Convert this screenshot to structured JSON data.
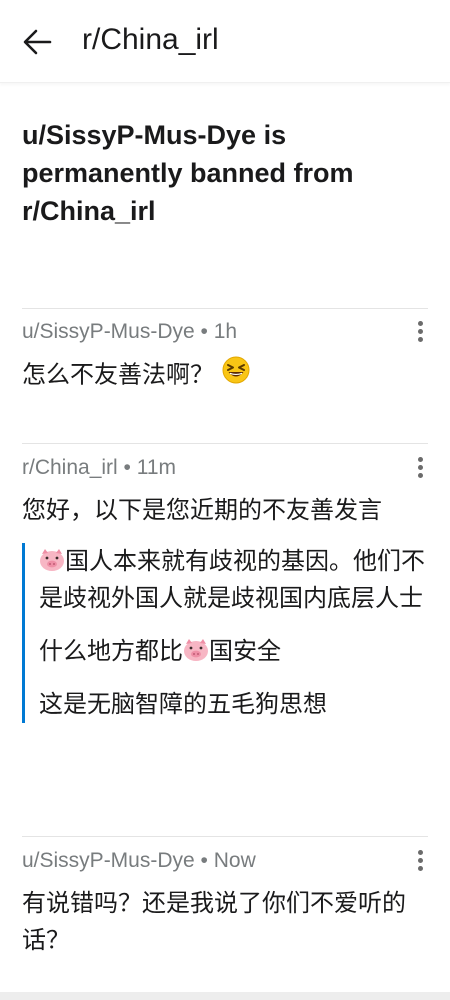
{
  "header": {
    "title": "r/China_irl",
    "back_icon": "back-arrow-icon"
  },
  "post": {
    "title": "u/SissyP-Mus-Dye is permanently banned from r/China_irl"
  },
  "comments": [
    {
      "author": "u/SissyP-Mus-Dye",
      "time": "1h",
      "text": "怎么不友善法啊？",
      "emoji": "grinning-squinting-face-icon"
    },
    {
      "author": "r/China_irl",
      "time": "11m",
      "text": "您好，以下是您近期的不友善发言",
      "quotes": [
        {
          "before": "",
          "pig": true,
          "after": "国人本来就有歧视的基因。他们不是歧视外国人就是歧视国内底层人士"
        },
        {
          "before": "什么地方都比",
          "pig": true,
          "after": "国安全"
        },
        {
          "before": "这是无脑智障的五毛狗思想",
          "pig": false,
          "after": ""
        }
      ]
    },
    {
      "author": "u/SissyP-Mus-Dye",
      "time": "Now",
      "text": "有说错吗？还是我说了你们不爱听的话？"
    }
  ],
  "meta_separator": " • ",
  "colors": {
    "accent_quote_bar": "#0079d3",
    "meta_text": "#787c7e"
  }
}
